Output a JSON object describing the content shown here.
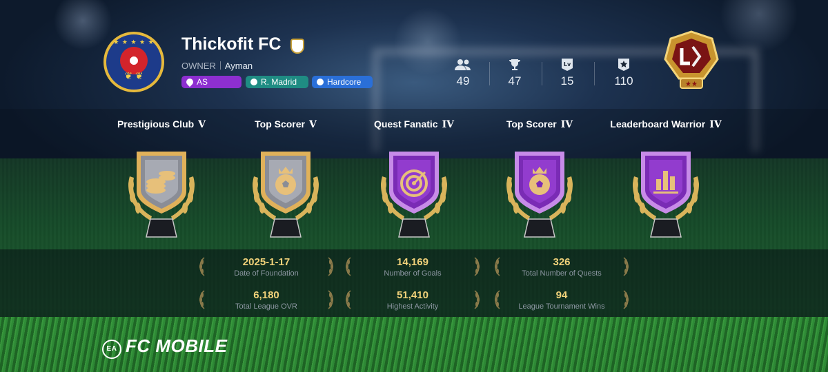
{
  "club": {
    "name": "Thickofit FC",
    "owner_label": "OWNER",
    "owner_name": "Ayman",
    "tags": {
      "region": "AS",
      "team": "R. Madrid",
      "style": "Hardcore"
    }
  },
  "stats": {
    "members": "49",
    "trophies": "47",
    "level": "15",
    "rank": "110",
    "level_icon_text": "Lv"
  },
  "achievements": [
    {
      "title": "Prestigious Club",
      "tier": "V",
      "icon": "coins-icon",
      "color": "silver"
    },
    {
      "title": "Top Scorer",
      "tier": "V",
      "icon": "ball-crown-icon",
      "color": "silver"
    },
    {
      "title": "Quest Fanatic",
      "tier": "IV",
      "icon": "target-icon",
      "color": "purple"
    },
    {
      "title": "Top Scorer",
      "tier": "IV",
      "icon": "ball-crown-icon",
      "color": "purple"
    },
    {
      "title": "Leaderboard Warrior",
      "tier": "IV",
      "icon": "bar-chart-icon",
      "color": "purple"
    }
  ],
  "club_stats": [
    {
      "value": "2025-1-17",
      "label": "Date of Foundation"
    },
    {
      "value": "14,169",
      "label": "Number of Goals"
    },
    {
      "value": "326",
      "label": "Total Number of Quests"
    },
    {
      "value": "6,180",
      "label": "Total League OVR"
    },
    {
      "value": "51,410",
      "label": "Highest Activity"
    },
    {
      "value": "94",
      "label": "League Tournament Wins"
    }
  ],
  "brand": {
    "ea": "EA",
    "name": "FC MOBILE"
  },
  "colors": {
    "gold": "#f1d27a",
    "purple": "#8d2fd0",
    "teal": "#1f8c83",
    "blue": "#2a6fd8"
  }
}
